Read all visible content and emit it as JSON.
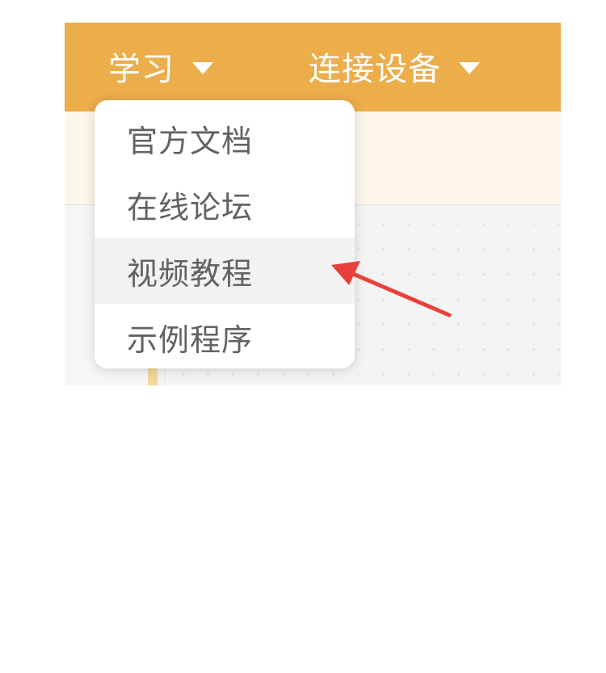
{
  "topbar": {
    "background": "#ecad4b",
    "nav": [
      {
        "label": "学习",
        "icon": "caret-down-icon"
      },
      {
        "label": "连接设备",
        "icon": "caret-down-icon"
      }
    ]
  },
  "dropdown": {
    "items": [
      {
        "label": "官方文档"
      },
      {
        "label": "在线论坛"
      },
      {
        "label": "视频教程",
        "highlighted": true
      },
      {
        "label": "示例程序"
      }
    ]
  },
  "annotation": {
    "type": "arrow",
    "color": "#e8403a",
    "points_to": "视频教程"
  }
}
